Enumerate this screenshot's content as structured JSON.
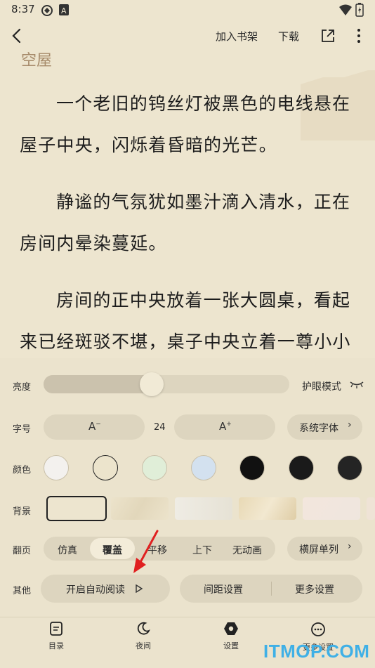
{
  "status_bar": {
    "time": "8:37"
  },
  "top_bar": {
    "add_to_shelf": "加入书架",
    "download": "下载"
  },
  "reader": {
    "chapter_tail": "空屋",
    "paragraphs": [
      [
        "一个老旧的钨丝灯被黑色的电线悬在",
        "屋子中央，闪烁着昏暗的光芒。"
      ],
      [
        "静谧的气氛犹如墨汁滴入清水，正在",
        "房间内晕染蔓延。"
      ],
      [
        "房间的正中央放着一张大圆桌，看起",
        "来已经斑驳不堪，桌子中央立着一尊小小"
      ]
    ]
  },
  "settings": {
    "brightness": {
      "label": "亮度",
      "level": 0.44,
      "eye_mode": "护眼模式"
    },
    "font_size": {
      "label": "字号",
      "value": "24",
      "font_button": "系统字体"
    },
    "color": {
      "label": "颜色",
      "swatches": [
        "#f3f1ee",
        "#ece4cc",
        "#e0eed8",
        "#d3e1ef",
        "#111111",
        "#1a1a1a",
        "#242424"
      ],
      "selected_index": 1
    },
    "background": {
      "label": "背景",
      "selected_index": 0
    },
    "page_turn": {
      "label": "翻页",
      "options": [
        "仿真",
        "覆盖",
        "平移",
        "上下",
        "无动画"
      ],
      "selected_index": 1,
      "layout_button": "横屏单列"
    },
    "other": {
      "label": "其他",
      "auto_read": "开启自动阅读",
      "spacing": "间距设置",
      "more": "更多设置"
    }
  },
  "bottom_nav": {
    "toc": "目录",
    "night": "夜间",
    "settings": "设置",
    "more": "更多设置"
  },
  "watermark": "ITMOP.COM",
  "colors": {
    "accent_arrow": "#e02020",
    "pill": "#ddd5bf",
    "selected_pill": "#f3ecd9"
  }
}
